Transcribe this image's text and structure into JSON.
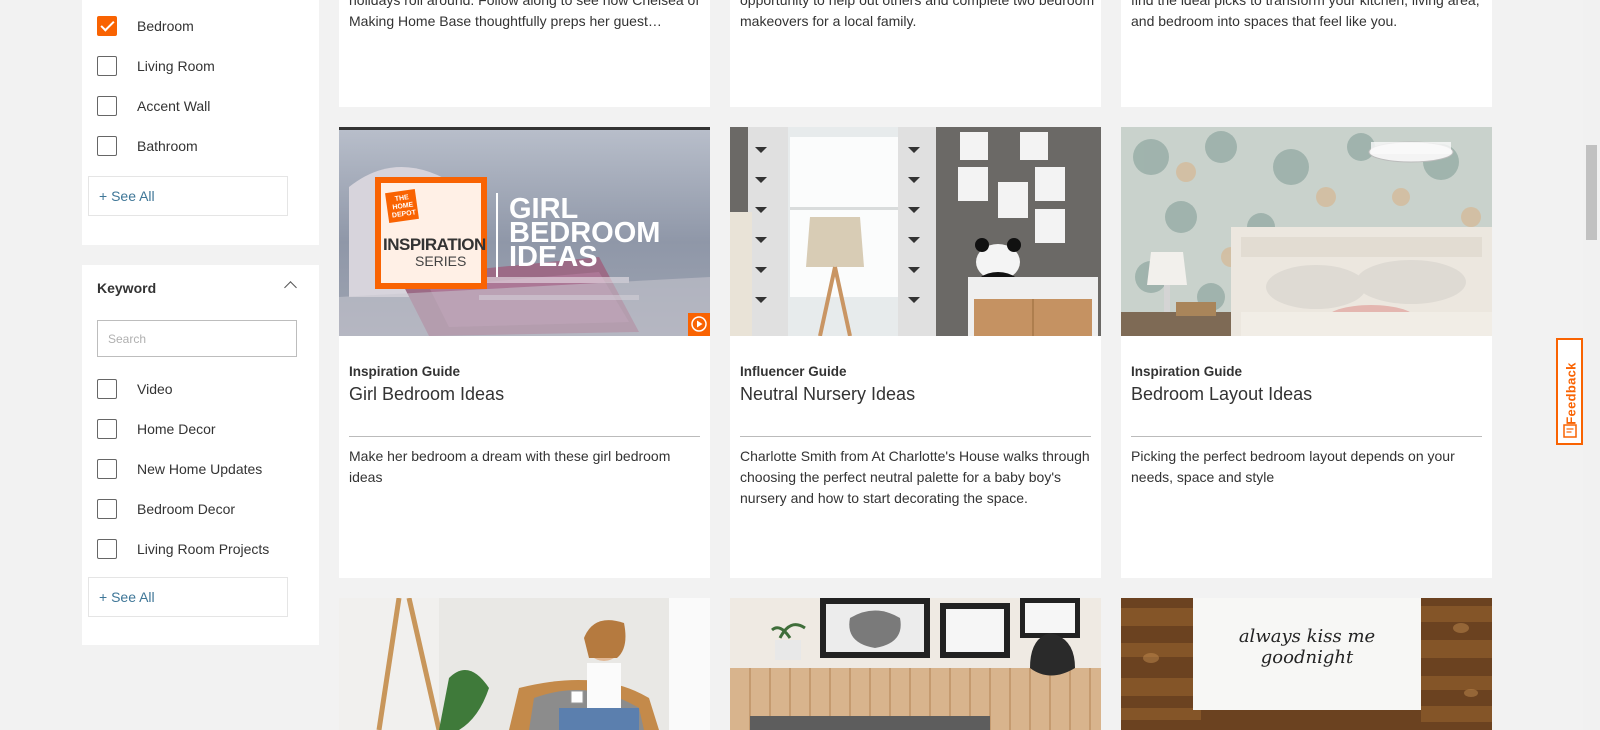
{
  "filters": {
    "room_items": [
      {
        "label": "Bedroom",
        "checked": true
      },
      {
        "label": "Living Room",
        "checked": false
      },
      {
        "label": "Accent Wall",
        "checked": false
      },
      {
        "label": "Bathroom",
        "checked": false
      }
    ],
    "room_see_all": "+ See All",
    "keyword": {
      "title": "Keyword",
      "search_placeholder": "Search",
      "items": [
        {
          "label": "Video",
          "checked": false
        },
        {
          "label": "Home Decor",
          "checked": false
        },
        {
          "label": "New Home Updates",
          "checked": false
        },
        {
          "label": "Bedroom Decor",
          "checked": false
        },
        {
          "label": "Living Room Projects",
          "checked": false
        }
      ],
      "see_all": "+ See All"
    }
  },
  "top_cards": [
    {
      "desc": "holidays roll around. Follow along to see how Chelsea of Making Home Base thoughtfully preps her guest…"
    },
    {
      "desc": "opportunity to help out others and complete two bedroom makeovers for a local family."
    },
    {
      "desc": "find the ideal picks to transform your kitchen, living area, and bedroom into spaces that feel like you."
    }
  ],
  "cards": [
    {
      "kicker": "Inspiration Guide",
      "title": "Girl Bedroom Ideas",
      "desc": "Make her bedroom a dream with these girl bedroom ideas",
      "thumb": {
        "logo_line1": "THE HOME DEPOT",
        "logo_line2": "INSPIRATION",
        "logo_line3": "SERIES",
        "headline": [
          "GIRL",
          "BEDROOM",
          "IDEAS"
        ],
        "video_icon": "play-icon"
      }
    },
    {
      "kicker": "Influencer Guide",
      "title": "Neutral Nursery Ideas",
      "desc": "Charlotte Smith from At Charlotte's House walks through choosing the perfect neutral palette for a baby boy's nursery and how to start decorating the space."
    },
    {
      "kicker": "Inspiration Guide",
      "title": "Bedroom Layout Ideas",
      "desc": "Picking the perfect bedroom layout depends on your needs, space and style"
    }
  ],
  "bottom_cards": [
    {
      "image": "woman-in-chair-photo"
    },
    {
      "image": "bedroom-headboard-photo"
    },
    {
      "image": "wood-wall-sign-photo",
      "sign_text": "always kiss me goodnight"
    }
  ],
  "feedback": {
    "label": "Feedback"
  },
  "colors": {
    "accent": "#f96302",
    "link": "#3e7697"
  }
}
